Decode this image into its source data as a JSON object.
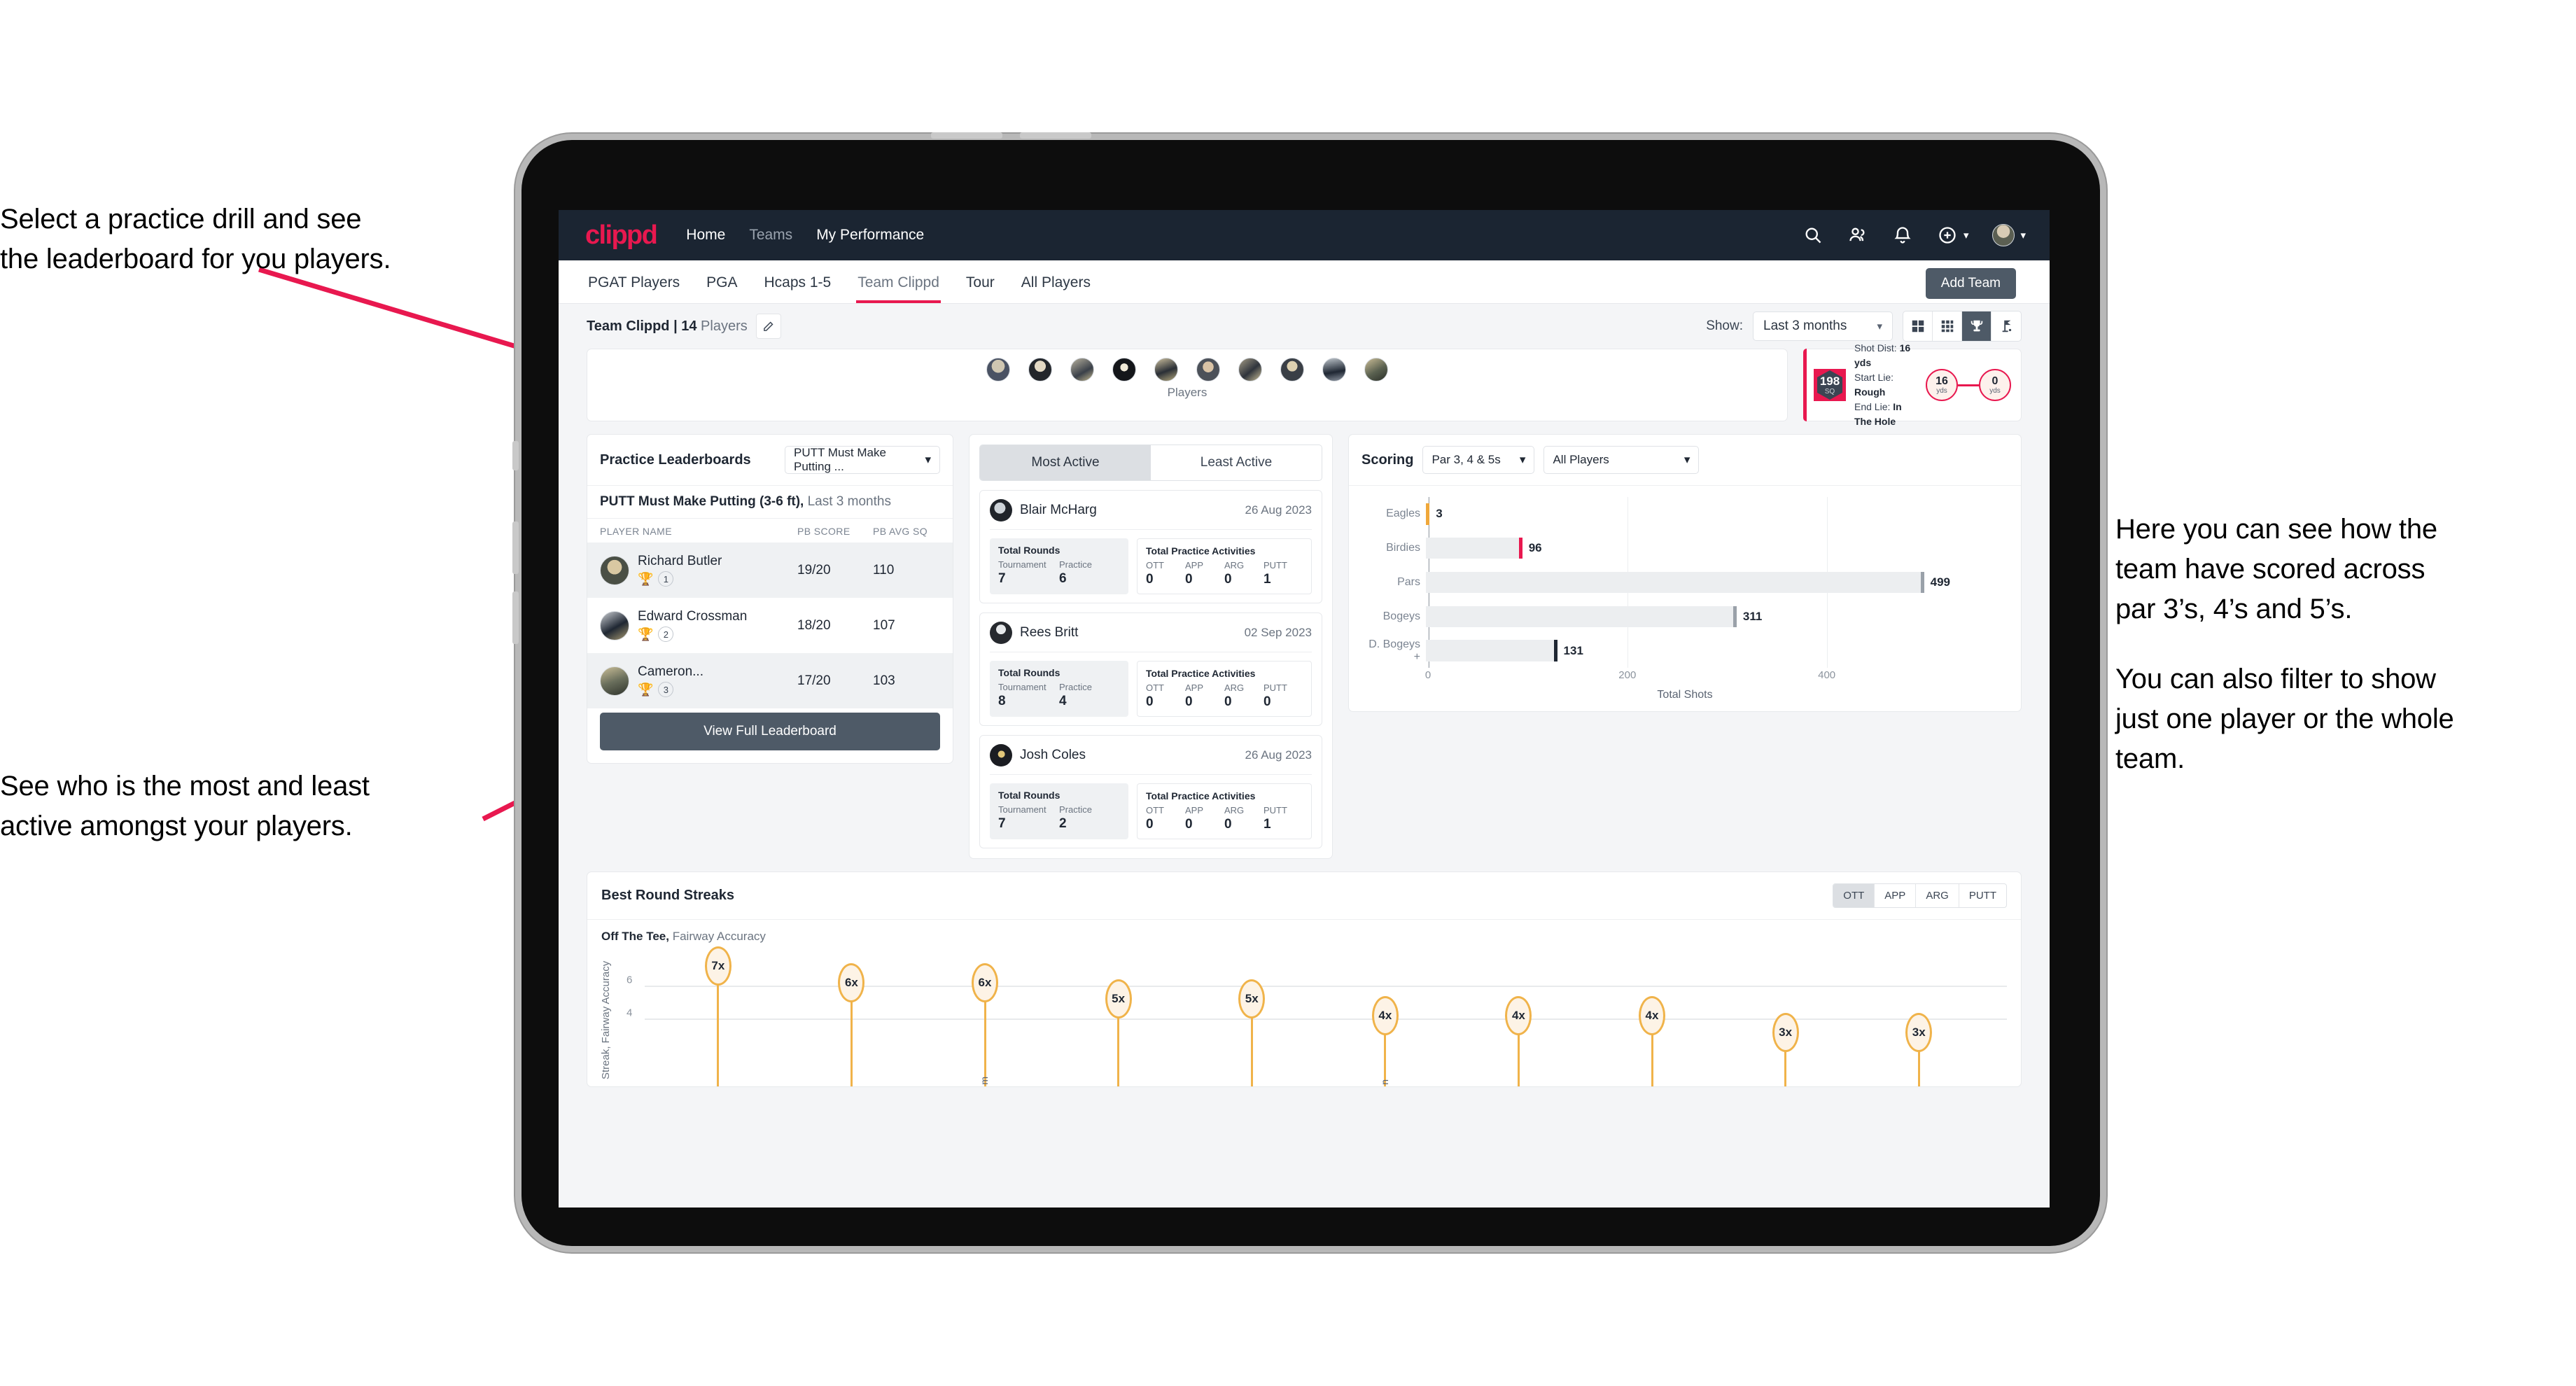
{
  "annotations": {
    "practice": [
      "Select a practice drill and see",
      "the leaderboard for you players."
    ],
    "active": [
      "See who is the most and least",
      "active amongst your players."
    ],
    "scoring_p1": [
      "Here you can see how the",
      "team have scored across",
      "par 3’s, 4’s and 5’s."
    ],
    "scoring_p2": [
      "You can also filter to show",
      "just one player or the whole",
      "team."
    ]
  },
  "app": {
    "logo": "clippd",
    "nav": [
      {
        "label": "Home",
        "dim": false
      },
      {
        "label": "Teams",
        "dim": true
      },
      {
        "label": "My Performance",
        "dim": false
      }
    ],
    "nav_icons": [
      "search-icon",
      "people-icon",
      "bell-icon",
      "plus-circle-icon",
      "avatar"
    ],
    "tabs": [
      {
        "label": "PGAT Players",
        "active": false
      },
      {
        "label": "PGA",
        "active": false
      },
      {
        "label": "Hcaps 1-5",
        "active": false
      },
      {
        "label": "Team Clippd",
        "active": true
      },
      {
        "label": "Tour",
        "active": false
      },
      {
        "label": "All Players",
        "active": false
      }
    ],
    "add_team_label": "Add Team",
    "team_label_bold": "Team Clippd | 14",
    "team_label_rest": " Players",
    "show_label": "Show:",
    "show_value": "Last 3 months",
    "view_modes": [
      "grid-large-icon",
      "grid-small-icon",
      "trophy-icon",
      "golf-flag-icon"
    ],
    "view_active_index": 2
  },
  "players_strip": {
    "caption": "Players",
    "count": 10
  },
  "shot_card": {
    "sq_value": "198",
    "sq_unit": "SQ",
    "lines": [
      {
        "label": "Shot Dist: ",
        "value": "16 yds"
      },
      {
        "label": "Start Lie: ",
        "value": "Rough"
      },
      {
        "label": "End Lie: ",
        "value": "In The Hole"
      }
    ],
    "start_dist": "16",
    "start_unit": "yds",
    "end_dist": "0",
    "end_unit": "yds"
  },
  "leaderboard": {
    "title": "Practice Leaderboards",
    "drill_select": "PUTT Must Make Putting ...",
    "subtitle_bold": "PUTT Must Make Putting (3-6 ft),",
    "subtitle_rest": " Last 3 months",
    "columns": [
      "PLAYER NAME",
      "PB SCORE",
      "PB AVG SQ"
    ],
    "rows": [
      {
        "name": "Richard Butler",
        "rank": "1",
        "trophy": "gold",
        "score": "19/20",
        "avg": "110"
      },
      {
        "name": "Edward Crossman",
        "rank": "2",
        "trophy": "silver",
        "score": "18/20",
        "avg": "107"
      },
      {
        "name": "Cameron...",
        "rank": "3",
        "trophy": "bronze",
        "score": "17/20",
        "avg": "103"
      }
    ],
    "button": "View Full Leaderboard"
  },
  "activity": {
    "tabs": [
      {
        "label": "Most Active",
        "active": true
      },
      {
        "label": "Least Active",
        "active": false
      }
    ],
    "rounds_title": "Total Rounds",
    "rounds_cols": [
      "Tournament",
      "Practice"
    ],
    "practice_title": "Total Practice Activities",
    "practice_cols": [
      "OTT",
      "APP",
      "ARG",
      "PUTT"
    ],
    "cards": [
      {
        "name": "Blair McHarg",
        "date": "26 Aug 2023",
        "tournament": "7",
        "practice": "6",
        "ott": "0",
        "app": "0",
        "arg": "0",
        "putt": "1"
      },
      {
        "name": "Rees Britt",
        "date": "02 Sep 2023",
        "tournament": "8",
        "practice": "4",
        "ott": "0",
        "app": "0",
        "arg": "0",
        "putt": "0"
      },
      {
        "name": "Josh Coles",
        "date": "26 Aug 2023",
        "tournament": "7",
        "practice": "2",
        "ott": "0",
        "app": "0",
        "arg": "0",
        "putt": "1"
      }
    ]
  },
  "scoring": {
    "title": "Scoring",
    "par_select": "Par 3, 4 & 5s",
    "player_select": "All Players"
  },
  "streaks": {
    "title": "Best Round Streaks",
    "toggle": [
      {
        "label": "OTT",
        "active": true
      },
      {
        "label": "APP",
        "active": false
      },
      {
        "label": "ARG",
        "active": false
      },
      {
        "label": "PUTT",
        "active": false
      }
    ],
    "sub_bold": "Off The Tee,",
    "sub_rest": " Fairway Accuracy"
  },
  "chart_data": [
    {
      "type": "bar",
      "orientation": "horizontal",
      "title": "Scoring",
      "categories": [
        "Eagles",
        "Birdies",
        "Pars",
        "Bogeys",
        "D. Bogeys +"
      ],
      "values": [
        3,
        96,
        499,
        311,
        131
      ],
      "cap_colors": [
        "#f0a83a",
        "#e8184f",
        "#9aa1a9",
        "#9aa1a9",
        "#1f2733"
      ],
      "xlabel": "Total Shots",
      "ylabel": "",
      "xticks": [
        0,
        200,
        400
      ],
      "xlim": [
        0,
        540
      ],
      "grid": true,
      "legend": "none"
    },
    {
      "type": "bar",
      "orientation": "vertical-lollipop",
      "title": "Best Round Streaks",
      "subtitle": "Off The Tee, Fairway Accuracy",
      "ylabel": "Streak, Fairway Accuracy",
      "yticks": [
        4,
        6
      ],
      "ylim": [
        0,
        8
      ],
      "categories": [
        "",
        "",
        "m",
        "",
        "",
        "n",
        "",
        "",
        "",
        ""
      ],
      "values": [
        7,
        6,
        6,
        5,
        5,
        4,
        4,
        4,
        3,
        3
      ],
      "value_labels": [
        "7x",
        "6x",
        "6x",
        "5x",
        "5x",
        "4x",
        "4x",
        "4x",
        "3x",
        "3x"
      ],
      "grid": true,
      "legend": "none"
    }
  ]
}
